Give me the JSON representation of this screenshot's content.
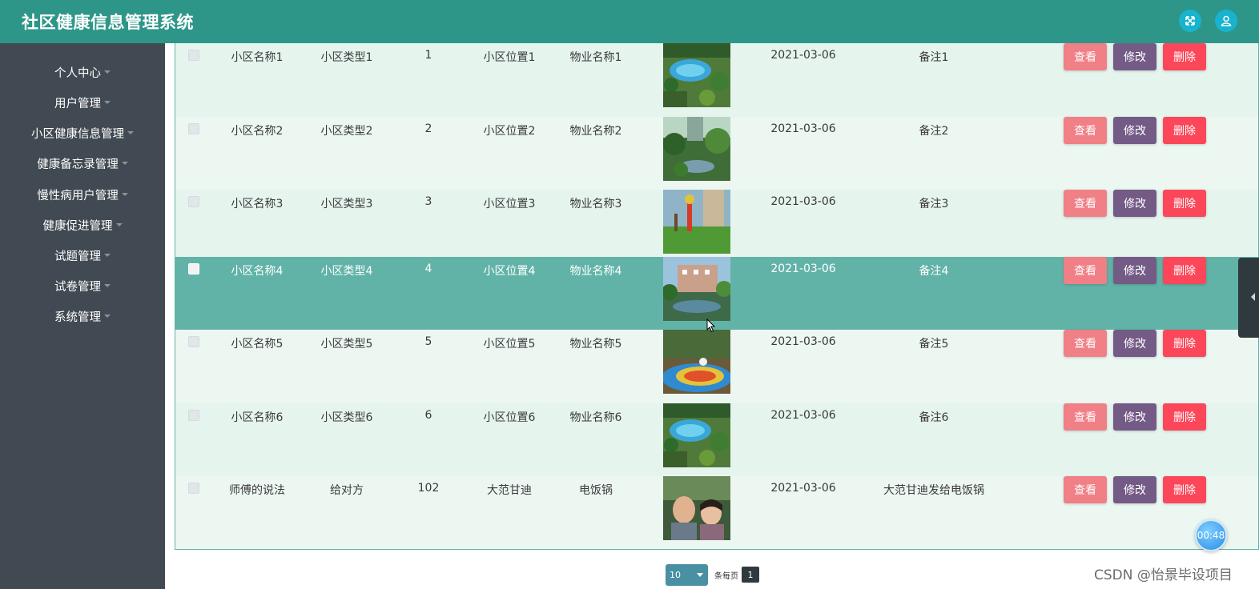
{
  "app": {
    "title": "社区健康信息管理系统"
  },
  "topbar": {
    "icons": [
      "fullscreen-icon",
      "user-icon"
    ]
  },
  "sidebar": {
    "items": [
      {
        "label": "个人中心"
      },
      {
        "label": "用户管理"
      },
      {
        "label": "小区健康信息管理"
      },
      {
        "label": "健康备忘录管理"
      },
      {
        "label": "慢性病用户管理"
      },
      {
        "label": "健康促进管理"
      },
      {
        "label": "试题管理"
      },
      {
        "label": "试卷管理"
      },
      {
        "label": "系统管理"
      }
    ]
  },
  "table": {
    "buttons": {
      "view": "查看",
      "edit": "修改",
      "delete": "删除"
    },
    "rows": [
      {
        "name": "小区名称1",
        "type": "小区类型1",
        "num": "1",
        "location": "小区位置1",
        "property": "物业名称1",
        "date": "2021-03-06",
        "remark": "备注1"
      },
      {
        "name": "小区名称2",
        "type": "小区类型2",
        "num": "2",
        "location": "小区位置2",
        "property": "物业名称2",
        "date": "2021-03-06",
        "remark": "备注2"
      },
      {
        "name": "小区名称3",
        "type": "小区类型3",
        "num": "3",
        "location": "小区位置3",
        "property": "物业名称3",
        "date": "2021-03-06",
        "remark": "备注3"
      },
      {
        "name": "小区名称4",
        "type": "小区类型4",
        "num": "4",
        "location": "小区位置4",
        "property": "物业名称4",
        "date": "2021-03-06",
        "remark": "备注4"
      },
      {
        "name": "小区名称5",
        "type": "小区类型5",
        "num": "5",
        "location": "小区位置5",
        "property": "物业名称5",
        "date": "2021-03-06",
        "remark": "备注5"
      },
      {
        "name": "小区名称6",
        "type": "小区类型6",
        "num": "6",
        "location": "小区位置6",
        "property": "物业名称6",
        "date": "2021-03-06",
        "remark": "备注6"
      },
      {
        "name": "师傅的说法",
        "type": "给对方",
        "num": "102",
        "location": "大范甘迪",
        "property": "电饭锅",
        "date": "2021-03-06",
        "remark": "大范甘迪发给电饭锅"
      }
    ]
  },
  "pagination": {
    "page_size": "10",
    "per_page_label": "条每页",
    "current_page": "1"
  },
  "timer": {
    "text": "00:48"
  },
  "watermark": {
    "text": "CSDN @怡景毕设项目"
  },
  "colors": {
    "header": "#2e9688",
    "sidebar": "#414a52",
    "selected_row": "#62b3a7",
    "btn_view": "#f07f86",
    "btn_edit": "#735b86",
    "btn_delete": "#fb4759"
  }
}
